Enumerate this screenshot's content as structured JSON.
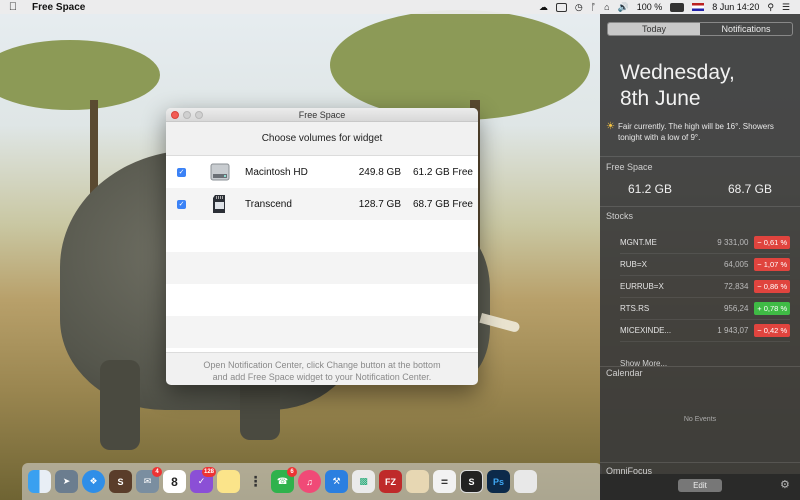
{
  "menubar": {
    "app_name": "Free Space",
    "battery": "100 %",
    "date_time": "8 Jun  14:20"
  },
  "dialog": {
    "title": "Free Space",
    "heading": "Choose volumes for widget",
    "volumes": [
      {
        "name": "Macintosh HD",
        "size": "249.8  GB",
        "free": "61.2 GB Free",
        "checked": true
      },
      {
        "name": "Transcend",
        "size": "128.7  GB",
        "free": "68.7 GB Free",
        "checked": true
      }
    ],
    "footer_line1": "Open Notification Center, click Change button at the bottom",
    "footer_line2": "and add Free Space widget to your Notification Center."
  },
  "dock": {
    "badges": {
      "mail": "4",
      "omnifocus": "128",
      "facetime": "6"
    },
    "calendar_day": "8",
    "filezilla": "FZ",
    "photoshop": "Ps"
  },
  "notification_center": {
    "tabs": [
      "Today",
      "Notifications"
    ],
    "weekday": "Wednesday,",
    "date": "8th June",
    "weather": "Fair currently. The high will be 16°. Showers tonight with a low of 9°.",
    "free_space_label": "Free Space",
    "free_space_values": [
      "61.2 GB",
      "68.7 GB"
    ],
    "stocks_label": "Stocks",
    "stocks": [
      {
        "symbol": "MGNT.ME",
        "price": "9 331,00",
        "change": "− 0,61 %",
        "direction": "down"
      },
      {
        "symbol": "RUB=X",
        "price": "64,005",
        "change": "− 1,07 %",
        "direction": "down"
      },
      {
        "symbol": "EURRUB=X",
        "price": "72,834",
        "change": "− 0,86 %",
        "direction": "down"
      },
      {
        "symbol": "RTS.RS",
        "price": "956,24",
        "change": "+ 0,78 %",
        "direction": "up"
      },
      {
        "symbol": "MICEXINDE...",
        "price": "1 943,07",
        "change": "− 0,42 %",
        "direction": "down"
      }
    ],
    "show_more": "Show More...",
    "calendar_label": "Calendar",
    "no_events": "No Events",
    "omnifocus_label": "OmniFocus",
    "edit_label": "Edit"
  },
  "colors": {
    "accent": "#3b82f6",
    "stock_down": "#e0443e",
    "stock_up": "#3fbb45"
  }
}
